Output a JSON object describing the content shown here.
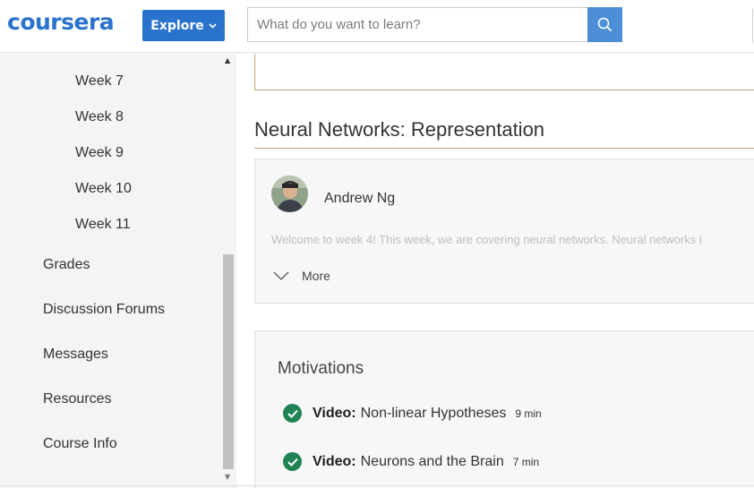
{
  "header": {
    "logo_text": "coursera",
    "explore_label": "Explore",
    "search_placeholder": "What do you want to learn?"
  },
  "sidebar": {
    "weeks": [
      "Week 7",
      "Week 8",
      "Week 9",
      "Week 10",
      "Week 11"
    ],
    "items": [
      "Grades",
      "Discussion Forums",
      "Messages",
      "Resources",
      "Course Info"
    ]
  },
  "main": {
    "section_title": "Neural Networks: Representation",
    "intro": {
      "author": "Andrew Ng",
      "text": "Welcome to week 4! This week, we are covering neural networks. Neural networks i",
      "more_label": "More"
    },
    "lesson": {
      "title": "Motivations",
      "items": [
        {
          "type": "Video:",
          "name": "Non-linear Hypotheses",
          "duration": "9 min"
        },
        {
          "type": "Video:",
          "name": "Neurons and the Brain",
          "duration": "7 min"
        }
      ]
    }
  },
  "colors": {
    "brand_blue": "#2a73cc",
    "complete_green": "#1f8354",
    "section_rule": "#b59d72"
  },
  "icons": [
    "search-icon",
    "chevron-down-icon",
    "check-icon",
    "scroll-up-arrow-icon",
    "scroll-down-arrow-icon"
  ]
}
